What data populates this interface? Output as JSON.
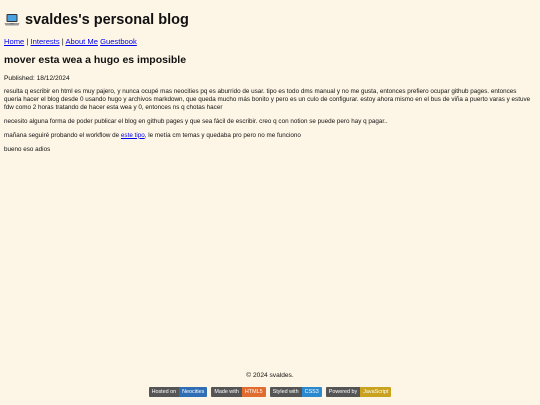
{
  "header": {
    "icon": "laptop-icon",
    "title": "svaldes's personal blog"
  },
  "nav": {
    "items": [
      {
        "label": "Home",
        "separator": "|"
      },
      {
        "label": "Interests",
        "separator": "|"
      },
      {
        "label": "About Me",
        "separator": ""
      },
      {
        "label": "Guestbook",
        "separator": ""
      }
    ]
  },
  "post": {
    "title": "mover esta wea a hugo es imposible",
    "published": "Published: 18/12/2024",
    "paragraphs": {
      "p1": "resulta q escribir en html es muy pajero, y nunca ocupé mas neocities pq es aburrido de usar. tipo es todo dms manual y no me gusta, entonces prefiero ocupar github pages. entonces queria hacer el blog desde 0 usando hugo y archivos markdown, que queda mucho más bonito y pero es un culo de configurar. estoy ahora mismo en el bus de viña a puerto varas y estuve fdw como 2 horas tratando de hacer esta wea y 0, entonces ns q chotas hacer",
      "p2": "necesito alguna forma de poder publicar el blog en github pages y que sea fácil de escribir. creo q con notion se puede pero hay q pagar..",
      "p3_before": "mañana seguiré probando el workflow de ",
      "p3_link": "este tipo",
      "p3_after": ", le metía cm temas y quedaba pro pero no me funciono",
      "p4": "bueno eso adios"
    }
  },
  "footer": {
    "copyright": "© 2024 svaldes.",
    "badges": [
      {
        "left": "Hosted on",
        "right": "Neocities",
        "color": "#2f6db5"
      },
      {
        "left": "Made with",
        "right": "HTML5",
        "color": "#e06c2e"
      },
      {
        "left": "Styled with",
        "right": "CSS3",
        "color": "#2a8ad0"
      },
      {
        "left": "Powered by",
        "right": "JavaScript",
        "color": "#c9a21f"
      }
    ]
  }
}
